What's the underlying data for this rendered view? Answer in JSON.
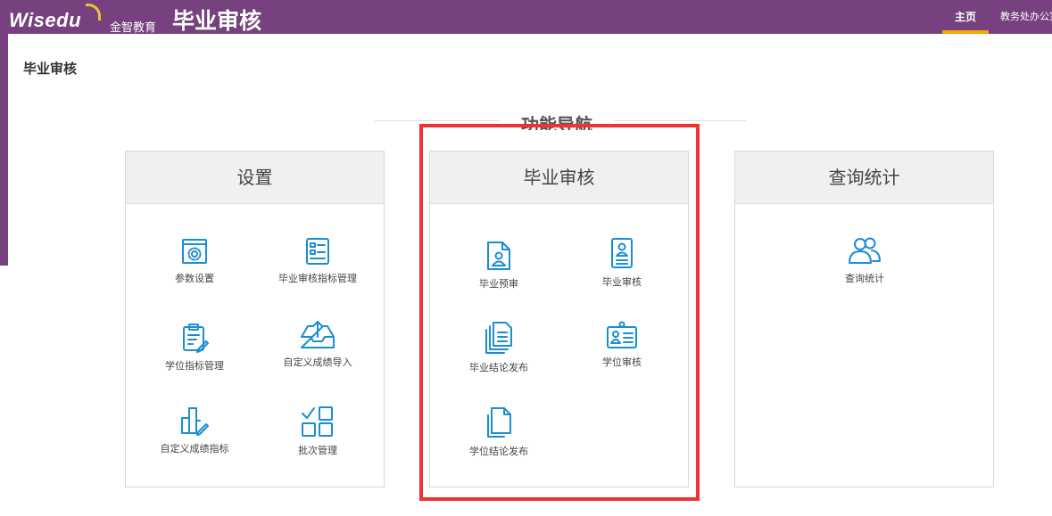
{
  "header": {
    "logo_text": "Wisedu",
    "brand_cn": "金智教育",
    "system_title": "毕业审核",
    "nav_home": "主页",
    "nav_office": "教务处办公室"
  },
  "page": {
    "title": "毕业审核"
  },
  "section": {
    "title": "功能导航"
  },
  "panels": [
    {
      "title": "设置",
      "items": [
        {
          "label": "参数设置",
          "icon": "gear-window-icon"
        },
        {
          "label": "毕业审核指标管理",
          "icon": "checklist-form-icon"
        },
        {
          "label": "学位指标管理",
          "icon": "clipboard-edit-icon"
        },
        {
          "label": "自定义成绩导入",
          "icon": "tray-upload-icon"
        },
        {
          "label": "自定义成绩指标",
          "icon": "bars-pen-icon"
        },
        {
          "label": "批次管理",
          "icon": "grid-check-icon"
        }
      ]
    },
    {
      "title": "毕业审核",
      "items": [
        {
          "label": "毕业预审",
          "icon": "document-person-icon"
        },
        {
          "label": "毕业审核",
          "icon": "id-card-person-icon"
        },
        {
          "label": "毕业结论发布",
          "icon": "stacked-documents-icon"
        },
        {
          "label": "学位审核",
          "icon": "badge-card-icon"
        },
        {
          "label": "学位结论发布",
          "icon": "blank-document-icon"
        }
      ]
    },
    {
      "title": "查询统计",
      "items": [
        {
          "label": "查询统计",
          "icon": "users-group-icon"
        }
      ]
    }
  ],
  "colors": {
    "header_bg": "#77407f",
    "accent": "#f5a800",
    "icon": "#1a8ed2",
    "highlight": "#ee3333"
  }
}
